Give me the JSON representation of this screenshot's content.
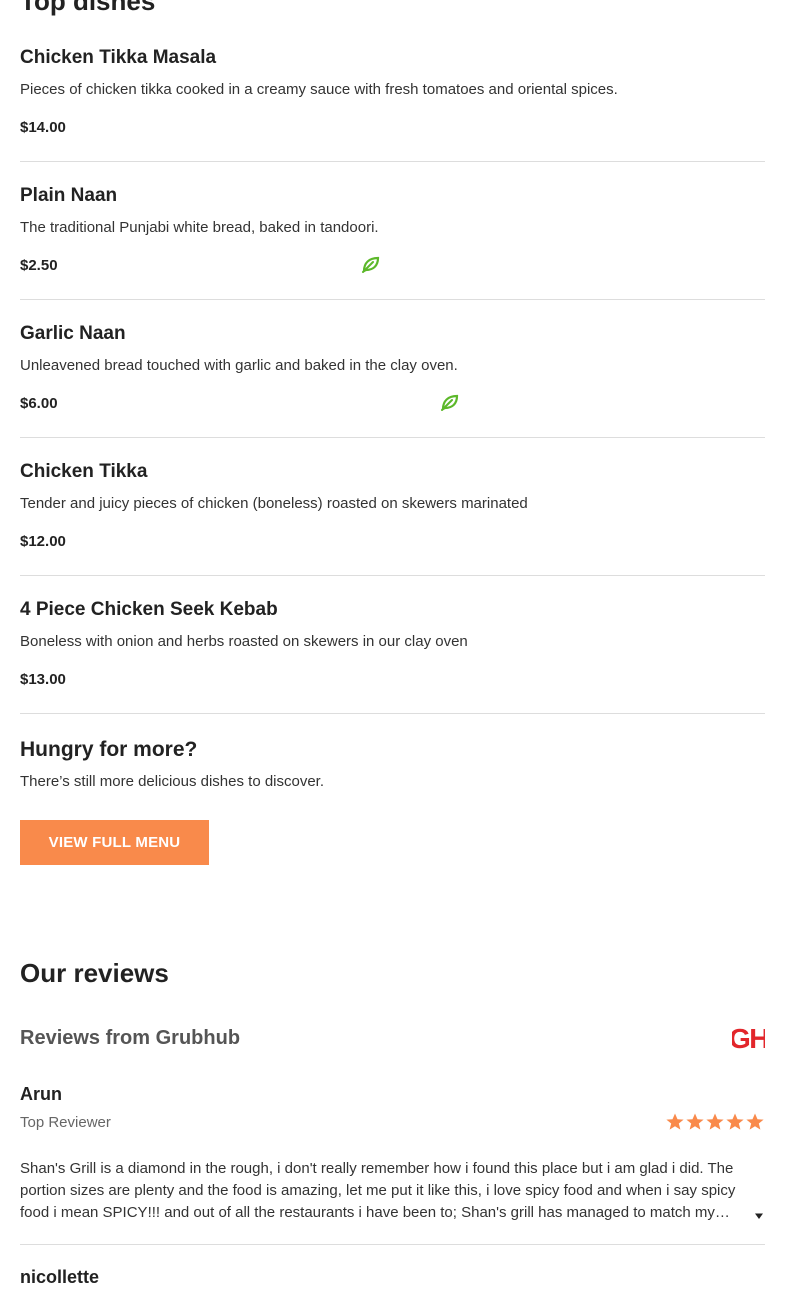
{
  "top_dishes": {
    "title": "Top dishes",
    "items": [
      {
        "name": "Chicken Tikka Masala",
        "description": "Pieces of chicken tikka cooked in a creamy sauce with fresh tomatoes and oriental spices.",
        "price": "$14.00",
        "vegetarian": false
      },
      {
        "name": "Plain Naan",
        "description": "The traditional Punjabi white bread, baked in tandoori.",
        "price": "$2.50",
        "vegetarian": true
      },
      {
        "name": "Garlic Naan",
        "description": "Unleavened bread touched with garlic and baked in the clay oven.",
        "price": "$6.00",
        "vegetarian": true
      },
      {
        "name": "Chicken Tikka",
        "description": "Tender and juicy pieces of chicken (boneless) roasted on skewers marinated",
        "price": "$12.00",
        "vegetarian": false
      },
      {
        "name": "4 Piece Chicken Seek Kebab",
        "description": "Boneless with onion and herbs roasted on skewers in our clay oven",
        "price": "$13.00",
        "vegetarian": false
      }
    ]
  },
  "more": {
    "title": "Hungry for more?",
    "subtitle": "There’s still more delicious dishes to discover.",
    "button_label": "VIEW FULL MENU"
  },
  "reviews": {
    "title": "Our reviews",
    "source_label": "Reviews from Grubhub",
    "logo_text": "GH",
    "items": [
      {
        "name": "Arun",
        "badge": "Top Reviewer",
        "rating": 5,
        "text": "Shan's Grill is a diamond in the rough, i don't really remember how i found this place but i am glad i did. The portion sizes are plenty and the food is amazing, let me put it like this, i love spicy food and when i say spicy food i mean SPICY!!! and out of all the restaurants i have been to; Shan's grill has managed to match my…"
      },
      {
        "name": "nicollette"
      }
    ]
  },
  "colors": {
    "accent": "#f98a4b",
    "veg_icon": "#5cb82a",
    "grubhub_red": "#e2262b",
    "star": "#f98a4b"
  },
  "icons": {
    "vegetarian": "leaf-icon",
    "rating": "star-icon",
    "expand": "caret-down-icon",
    "source_logo": "grubhub-logo"
  }
}
